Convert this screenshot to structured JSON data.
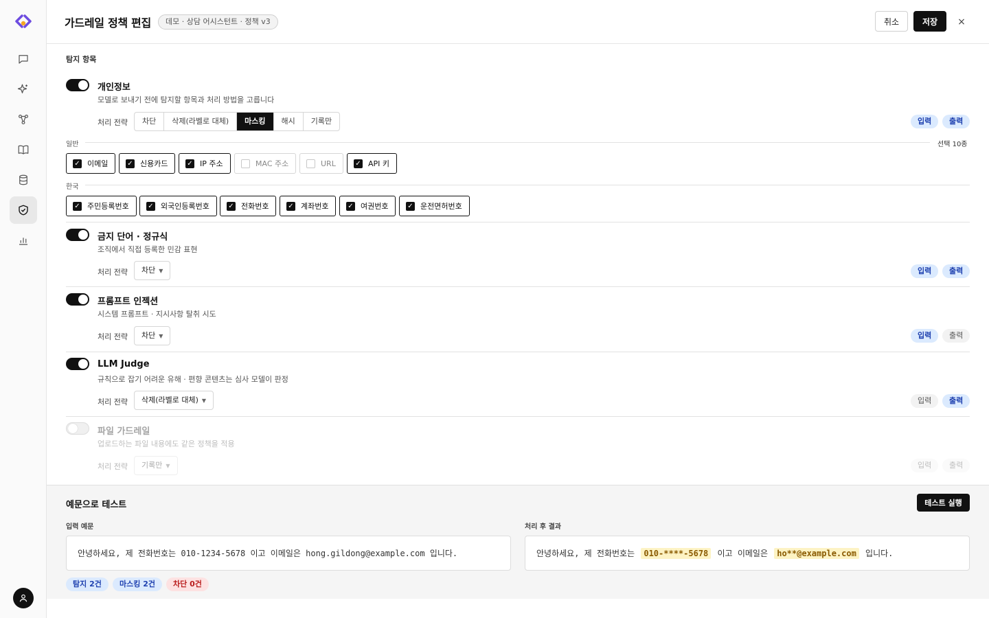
{
  "colors": {
    "accent": "#111111",
    "brand_orange": "#f5a623",
    "brand_purple": "#6d4ce0",
    "pill_blue_bg": "#dbeafe",
    "pill_blue_text": "#1e40af",
    "highlight_bg": "#fdf3c4",
    "stat_red_bg": "#fde2e2"
  },
  "sidebar": {
    "items": [
      {
        "icon": "chat-icon",
        "active": false
      },
      {
        "icon": "sparkle-icon",
        "active": false
      },
      {
        "icon": "workflow-icon",
        "active": false
      },
      {
        "icon": "book-icon",
        "active": false
      },
      {
        "icon": "database-icon",
        "active": false
      },
      {
        "icon": "shield-check-icon",
        "active": true
      },
      {
        "icon": "bar-chart-icon",
        "active": false
      }
    ],
    "avatar_icon": "user-icon"
  },
  "header": {
    "title": "가드레일 정책 편집",
    "context_badge": "데모 · 상담 어시스턴트 · 정책 v3",
    "cancel_label": "취소",
    "save_label": "저장",
    "close_glyph": "×"
  },
  "section_label": "탐지 항목",
  "strategy_label": "처리 전략",
  "io": {
    "input": "입력",
    "output": "출력"
  },
  "detectors": [
    {
      "title": "개인정보",
      "desc": "모델로 보내기 전에 탐지할 항목과 처리 방법을 고릅니다",
      "enabled": true,
      "strategy_options": [
        "차단",
        "삭제(라벨로 대체)",
        "마스킹",
        "해시",
        "기록만"
      ],
      "strategy_selected": "마스킹",
      "input_on": true,
      "output_on": true,
      "groups": [
        {
          "label": "일반",
          "count_label": "선택 10종",
          "items": [
            {
              "label": "이메일",
              "checked": true
            },
            {
              "label": "신용카드",
              "checked": true
            },
            {
              "label": "IP 주소",
              "checked": true
            },
            {
              "label": "MAC 주소",
              "checked": false
            },
            {
              "label": "URL",
              "checked": false
            },
            {
              "label": "API 키",
              "checked": true
            }
          ]
        },
        {
          "label": "한국",
          "items": [
            {
              "label": "주민등록번호",
              "checked": true
            },
            {
              "label": "외국인등록번호",
              "checked": true
            },
            {
              "label": "전화번호",
              "checked": true
            },
            {
              "label": "계좌번호",
              "checked": true
            },
            {
              "label": "여권번호",
              "checked": true
            },
            {
              "label": "운전면허번호",
              "checked": true
            }
          ]
        }
      ]
    },
    {
      "title": "금지 단어 · 정규식",
      "desc": "조직에서 직접 등록한 민감 표현",
      "enabled": true,
      "strategy": "차단",
      "input_on": true,
      "output_on": true
    },
    {
      "title": "프롬프트 인젝션",
      "desc": "시스템 프롬프트 · 지시사항 탈취 시도",
      "enabled": true,
      "strategy": "차단",
      "input_on": true,
      "output_on": false
    },
    {
      "title": "LLM Judge",
      "desc": "규칙으로 잡기 어려운 유해 · 편향 콘텐츠는 심사 모델이 판정",
      "enabled": true,
      "strategy": "삭제(라벨로 대체)",
      "input_on": false,
      "output_on": true
    },
    {
      "title": "파일 가드레일",
      "desc": "업로드하는 파일 내용에도 같은 정책을 적용",
      "enabled": false,
      "strategy": "기록만",
      "input_on": false,
      "output_on": false
    }
  ],
  "test": {
    "title": "예문으로 테스트",
    "run_label": "테스트 실행",
    "input_label": "입력 예문",
    "output_label": "처리 후 결과",
    "input_text": "안녕하세요, 제 전화번호는 010-1234-5678 이고 이메일은 hong.gildong@example.com 입니다.",
    "output_parts": {
      "t1": "안녕하세요, 제 전화번호는",
      "h1": "010-****-5678",
      "t2": "이고 이메일은",
      "h2": "ho**@example.com",
      "t3": "입니다."
    },
    "stats": [
      {
        "label": "탐지 2건",
        "tone": "blue"
      },
      {
        "label": "마스킹 2건",
        "tone": "blue"
      },
      {
        "label": "차단 0건",
        "tone": "red"
      }
    ]
  }
}
